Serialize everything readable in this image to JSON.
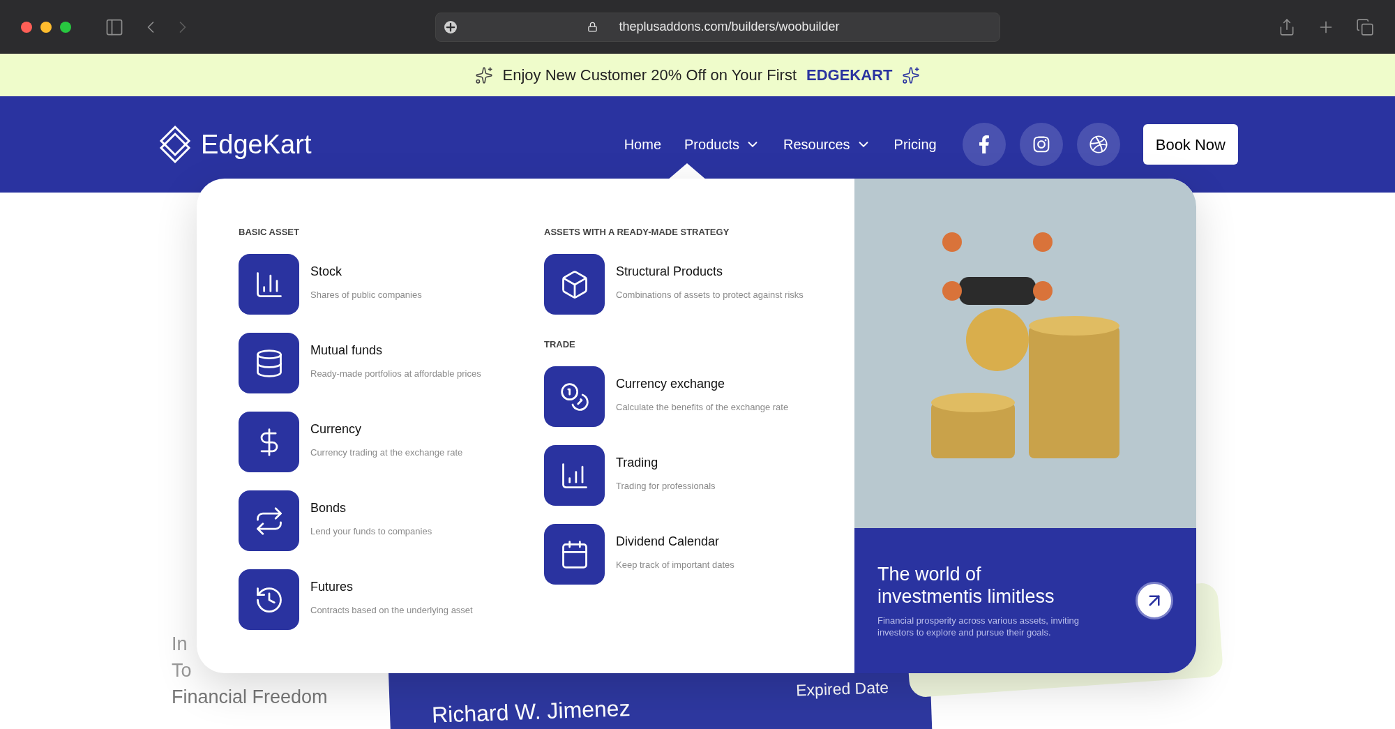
{
  "browser": {
    "url": "theplusaddons.com/builders/woobuilder"
  },
  "banner": {
    "text": "Enjoy New Customer 20% Off on Your First",
    "brand": "EDGEKART"
  },
  "nav": {
    "logo": "EdgeKart",
    "links": [
      {
        "label": "Home",
        "dropdown": false
      },
      {
        "label": "Products",
        "dropdown": true
      },
      {
        "label": "Resources",
        "dropdown": true
      },
      {
        "label": "Pricing",
        "dropdown": false
      }
    ],
    "social": [
      {
        "kind": "facebook"
      },
      {
        "kind": "instagram"
      },
      {
        "kind": "dribbble"
      }
    ],
    "cta": "Book Now"
  },
  "mega_menu": {
    "columns": [
      {
        "sections": [
          {
            "heading": "BASIC ASSET",
            "items": [
              {
                "kind": "chart",
                "title": "Stock",
                "description": "Shares of public companies"
              },
              {
                "kind": "database",
                "title": "Mutual funds",
                "description": "Ready-made portfolios at affordable prices"
              },
              {
                "kind": "dollar",
                "title": "Currency",
                "description": "Currency trading at the exchange rate"
              },
              {
                "kind": "transfer",
                "title": "Bonds",
                "description": "Lend your funds to companies"
              },
              {
                "kind": "clock",
                "title": "Futures",
                "description": "Contracts based on the underlying asset"
              }
            ]
          }
        ]
      },
      {
        "sections": [
          {
            "heading": "ASSETS WITH A READY-MADE STRATEGY",
            "items": [
              {
                "kind": "box",
                "title": "Structural Products",
                "description": "Combinations of assets to protect against risks"
              }
            ]
          },
          {
            "heading": "TRADE",
            "items": [
              {
                "kind": "exchange",
                "title": "Currency exchange",
                "description": "Calculate the benefits of the exchange rate"
              },
              {
                "kind": "trading",
                "title": "Trading",
                "description": "Trading for professionals"
              },
              {
                "kind": "calendar",
                "title": "Dividend Calendar",
                "description": "Keep track of important dates"
              }
            ]
          }
        ]
      }
    ],
    "promo": {
      "title": "The world of investmentis limitless",
      "text": "Financial prosperity across various assets, inviting investors to explore and pursue their goals."
    }
  },
  "hero": {
    "lines": [
      "In",
      "To",
      "Financial Freedom"
    ],
    "card": {
      "name": "Richard W. Jimenez",
      "label": "Expired Date"
    }
  }
}
